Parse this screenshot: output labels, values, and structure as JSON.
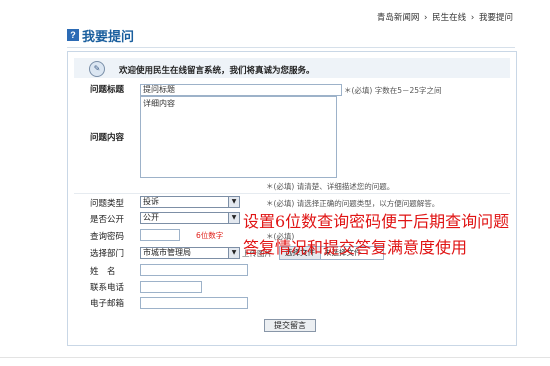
{
  "breadcrumb": [
    "青岛新闻网",
    "民生在线",
    "我要提问"
  ],
  "breadcrumb_sep": "›",
  "page": {
    "title": "我要提问",
    "title_icon_glyph": "?"
  },
  "welcome": {
    "text": "欢迎使用民生在线留言系统，我们将真诚为您服务。"
  },
  "form": {
    "subject": {
      "label": "问题标题",
      "value": "提问标题",
      "hint": "＊(必填) 字数在5－25字之间"
    },
    "content": {
      "label": "问题内容",
      "value": "详细内容",
      "hint": "＊(必填) 请清楚、详细描述您的问题。"
    },
    "category": {
      "label": "问题类型",
      "selected": "投诉",
      "hint": "＊(必填) 请选择正确的问题类型，以方便问题解答。"
    },
    "public": {
      "label": "是否公开",
      "selected": "公开"
    },
    "password": {
      "label": "查询密码",
      "value": "",
      "note": "6位数字",
      "hint": "＊(必填)"
    },
    "department": {
      "label": "选择部门",
      "selected": "市城市管理局"
    },
    "upload": {
      "label": "上传图片",
      "button": "选择文件",
      "status": "未选择文件"
    },
    "name": {
      "label": "姓　名",
      "value": ""
    },
    "phone": {
      "label": "联系电话",
      "value": ""
    },
    "email": {
      "label": "电子邮箱",
      "value": ""
    },
    "submit": "提交留言"
  },
  "overlay": {
    "line1": "设置6位数查询密码便于后期查询问题",
    "line2": "答复情况和提交答复满意度使用"
  },
  "colors": {
    "overlay": "#e01414",
    "title": "#1a5f9e",
    "welcome_bg": "#eef3f8",
    "panel_border": "#c9d7e6"
  }
}
